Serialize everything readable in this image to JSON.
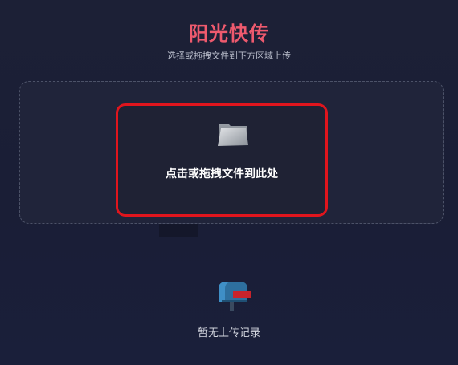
{
  "app": {
    "title": "阳光快传",
    "subtitle": "选择或拖拽文件到下方区域上传"
  },
  "upload": {
    "click_label": "点击或拖拽文件到此处",
    "icon": "folder-icon"
  },
  "history": {
    "empty_text": "暂无上传记录",
    "icon": "mailbox-icon"
  },
  "colors": {
    "title": "#ee5a6e",
    "highlight_border": "#e0151d",
    "background": "#1c2036"
  }
}
